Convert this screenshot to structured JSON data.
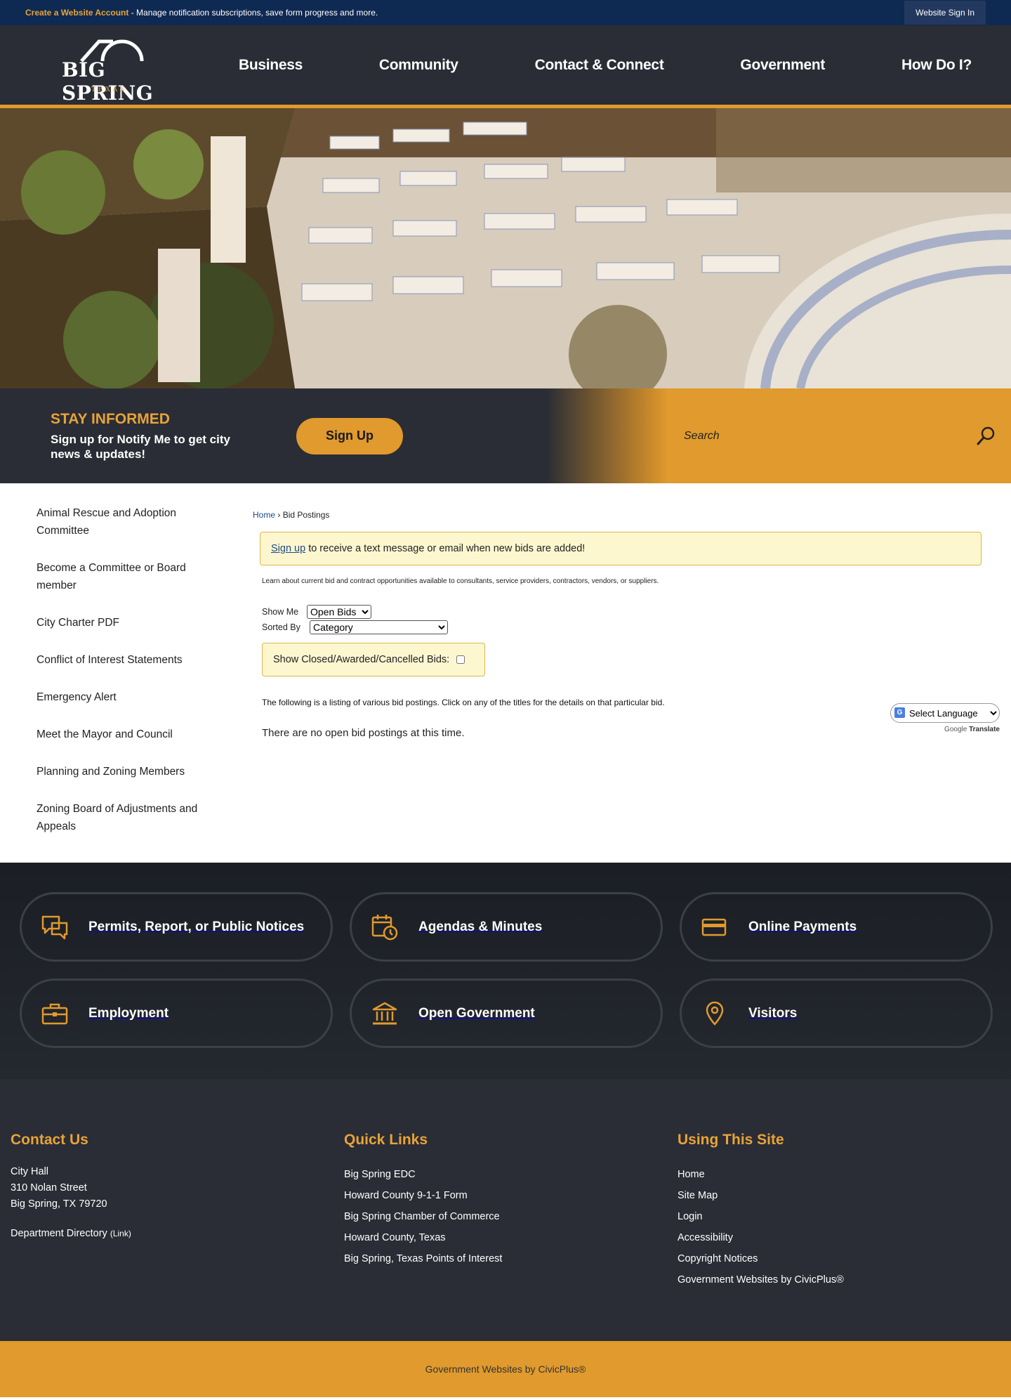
{
  "topbar": {
    "account_link": "Create a Website Account",
    "account_desc": " - Manage notification subscriptions, save form progress and more.",
    "sign_in": "Website Sign In"
  },
  "logo": {
    "name": "BIG SPRING",
    "sub": "TEXAS"
  },
  "nav": [
    "Business",
    "Community",
    "Contact & Connect",
    "Government",
    "How Do I?"
  ],
  "stay": {
    "title": "STAY INFORMED",
    "text_a": "Sign up for ",
    "text_b": "Notify Me",
    "text_c": " to get city news & updates!",
    "button": "Sign Up",
    "search_placeholder": "Search"
  },
  "sidenav": [
    "Animal Rescue and Adoption Committee",
    "Become a Committee or Board member",
    "City Charter PDF",
    "Conflict of Interest Statements",
    "Emergency Alert",
    "Meet the Mayor and Council",
    "Planning and Zoning Members",
    "Zoning Board of Adjustments and Appeals"
  ],
  "breadcrumb": {
    "home": "Home",
    "sep": " › ",
    "current": "Bid Postings"
  },
  "alert": {
    "link": "Sign up",
    "text": "to receive a text message or email when new bids are added!"
  },
  "learn": "Learn about current bid and contract opportunities available to consultants, service providers, contractors, vendors, or suppliers.",
  "filters": {
    "show_label": "Show Me",
    "show_value": "Open Bids",
    "sort_label": "Sorted By",
    "sort_value": "Category"
  },
  "closed_label": "Show Closed/Awarded/Cancelled Bids:",
  "listing": "The following is a listing of various bid postings. Click on any of the titles for the details on that particular bid.",
  "nobids": "There are no open bid postings at this time.",
  "translate": {
    "select": "Select Language",
    "powered_google": "Google",
    "powered_translate": "Translate"
  },
  "quick": [
    {
      "label": "Permits, Report, or Public Notices",
      "icon": "chat-bubbles-icon"
    },
    {
      "label": "Agendas & Minutes",
      "icon": "calendar-clock-icon"
    },
    {
      "label": "Online Payments",
      "icon": "credit-card-icon"
    },
    {
      "label": "Employment",
      "icon": "briefcase-icon"
    },
    {
      "label": "Open Government",
      "icon": "government-building-icon"
    },
    {
      "label": "Visitors",
      "icon": "location-pin-icon"
    }
  ],
  "footer": {
    "contact": {
      "title": "Contact Us",
      "line1": "City Hall",
      "line2": "310 Nolan Street",
      "line3": "Big Spring, TX 79720",
      "dept": "Department Directory",
      "dept_tag": "(Link)"
    },
    "quick_links": {
      "title": "Quick Links",
      "items": [
        "Big Spring EDC",
        "Howard County 9-1-1 Form",
        "Big Spring Chamber of Commerce",
        "Howard County, Texas",
        "Big Spring, Texas Points of Interest"
      ]
    },
    "using": {
      "title": "Using This Site",
      "items": [
        "Home",
        "Site Map",
        "Login",
        "Accessibility",
        "Copyright Notices",
        "Government Websites by CivicPlus®"
      ]
    }
  },
  "bottom": "Government Websites by CivicPlus®",
  "colors": {
    "navy": "#0f2a52",
    "dark": "#2a2d35",
    "accent": "#e09a2d"
  }
}
